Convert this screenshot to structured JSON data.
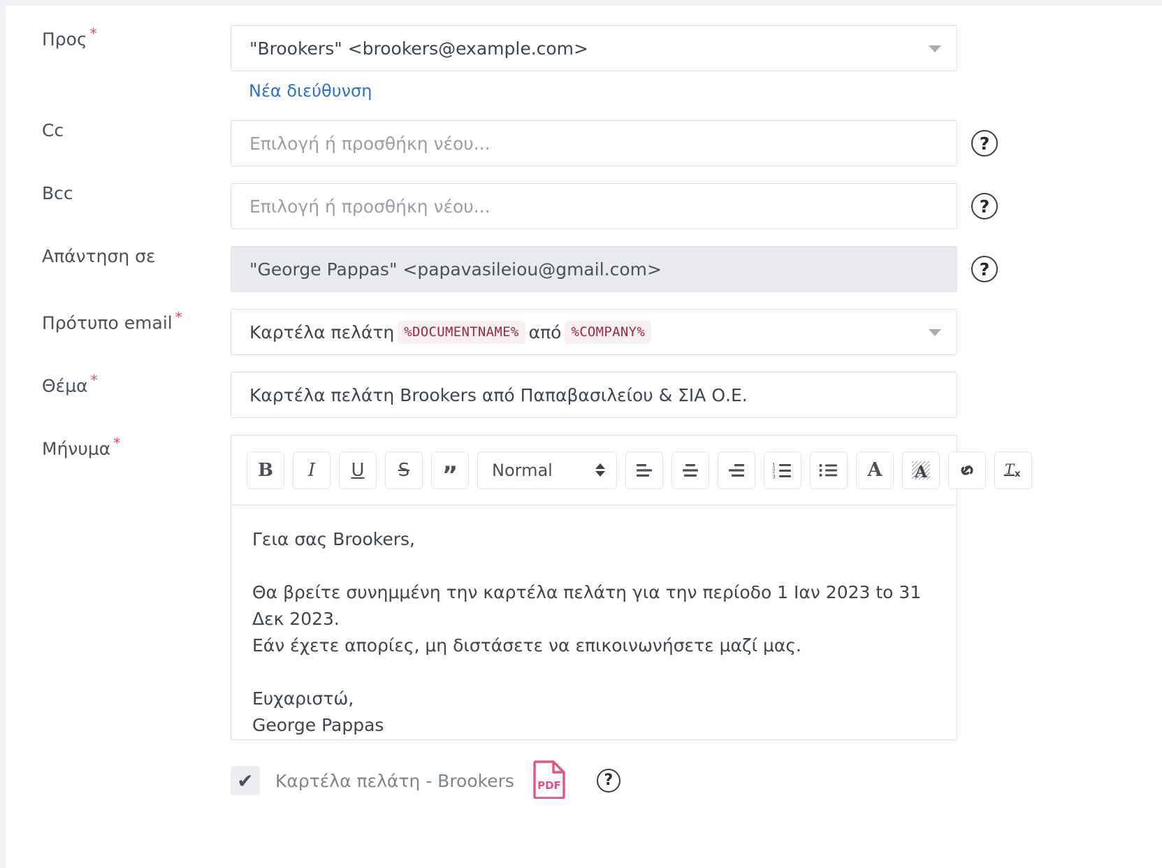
{
  "form": {
    "to": {
      "label": "Προς",
      "required": true,
      "value": "\"Brookers\" <brookers@example.com>",
      "new_address_link": "Νέα διεύθυνση"
    },
    "cc": {
      "label": "Cc",
      "required": false,
      "value": "",
      "placeholder": "Επιλογή ή προσθήκη νέου...",
      "help": "?"
    },
    "bcc": {
      "label": "Bcc",
      "required": false,
      "value": "",
      "placeholder": "Επιλογή ή προσθήκη νέου...",
      "help": "?"
    },
    "reply_to": {
      "label": "Απάντηση σε",
      "required": false,
      "value": "\"George Pappas\" <papavasileiou@gmail.com>",
      "help": "?",
      "disabled": true
    },
    "email_template": {
      "label": "Πρότυπο email",
      "required": true,
      "text_before": "Καρτέλα πελάτη",
      "tag1": "%DOCUMENTNAME%",
      "text_middle": "από",
      "tag2": "%COMPANY%"
    },
    "subject": {
      "label": "Θέμα",
      "required": true,
      "value": "Καρτέλα πελάτη Brookers από Παπαβασιλείου & ΣΙΑ Ο.Ε."
    },
    "message": {
      "label": "Μήνυμα",
      "required": true,
      "body": "Γεια σας Brookers,\n\nΘα βρείτε συνημμένη την καρτέλα πελάτη για την περίοδο 1 Ιαν 2023 to 31 Δεκ 2023.\nΕάν έχετε απορίες, μη διστάσετε να επικοινωνήσετε μαζί μας.\n\nΕυχαριστώ,\nGeorge Pappas"
    }
  },
  "toolbar": {
    "bold": "B",
    "italic": "I",
    "underline": "U",
    "strike": "S",
    "quote": "”",
    "format_select": "Normal",
    "align_left": "align-left",
    "align_center": "align-center",
    "align_right": "align-right",
    "ordered_list": "ordered-list",
    "bullet_list": "bullet-list",
    "text_color": "A",
    "highlight": "A",
    "link": "link",
    "clear_format": "Tx"
  },
  "attachment": {
    "checked": true,
    "check_glyph": "✔",
    "name": "Καρτέλα πελάτη - Brookers",
    "file_type": "PDF",
    "help": "?"
  },
  "colors": {
    "required_star": "#e0486b",
    "link": "#2f6fd0",
    "tag_bg": "#f8eff1",
    "tag_text": "#9b2a43",
    "pdf": "#e8527d",
    "page_bg": "#f0f1f5"
  }
}
